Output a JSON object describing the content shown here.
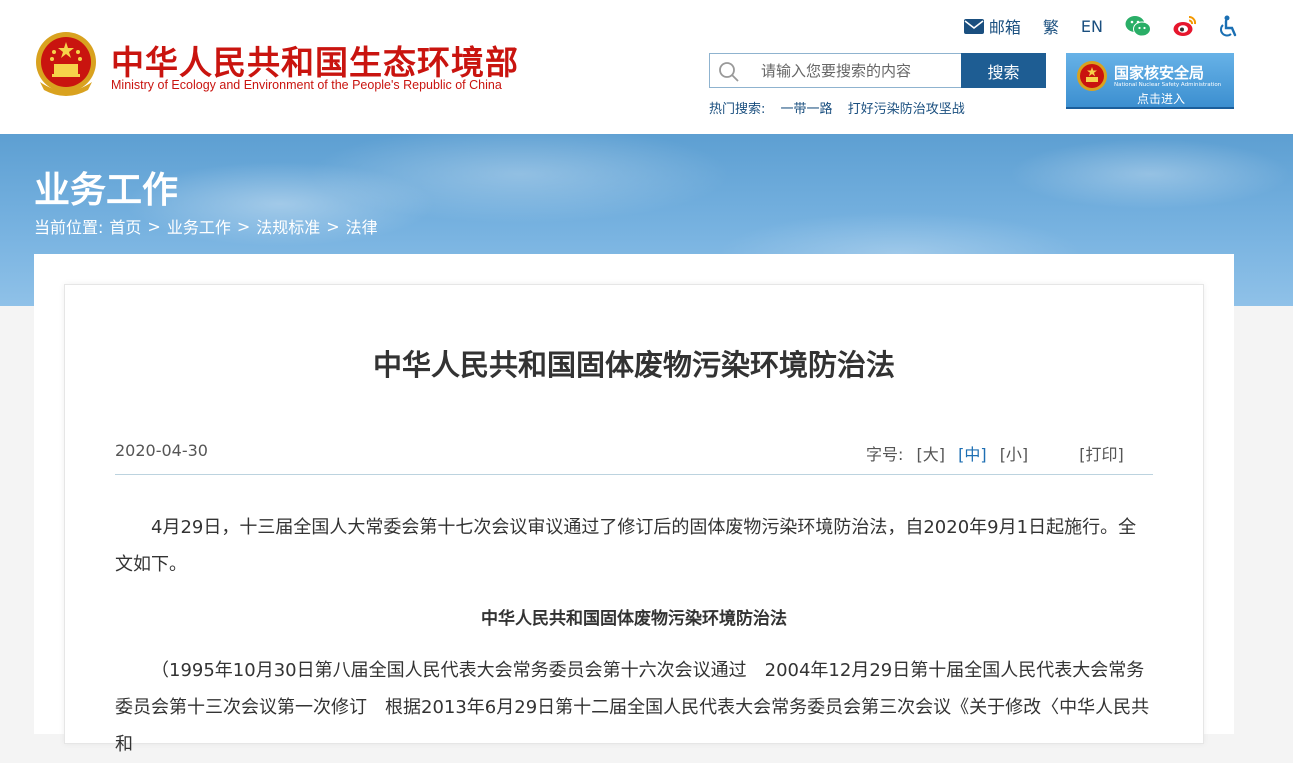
{
  "header": {
    "title_cn": "中华人民共和国生态环境部",
    "title_en": "Ministry of Ecology and Environment of the People's Republic of China",
    "toplinks": {
      "mail": "邮箱",
      "traditional": "繁",
      "english": "EN"
    },
    "search": {
      "placeholder": "请输入您要搜索的内容",
      "button": "搜索"
    },
    "hot": {
      "label": "热门搜索:",
      "items": [
        "一带一路",
        "打好污染防治攻坚战"
      ]
    },
    "nnsa": {
      "name_cn": "国家核安全局",
      "name_en": "National Nuclear Safety Administration",
      "enter": "点击进入"
    }
  },
  "banner": {
    "title": "业务工作",
    "breadcrumb": {
      "label": "当前位置:",
      "items": [
        "首页",
        "业务工作",
        "法规标准",
        "法律"
      ],
      "separator": ">"
    }
  },
  "article": {
    "title": "中华人民共和国固体废物污染环境防治法",
    "date": "2020-04-30",
    "font_size_label": "字号:",
    "font_sizes": [
      "[大]",
      "[中]",
      "[小]"
    ],
    "print": "[打印]",
    "paragraph1": "4月29日，十三届全国人大常委会第十七次会议审议通过了修订后的固体废物污染环境防治法，自2020年9月1日起施行。全文如下。",
    "subtitle": "中华人民共和国固体废物污染环境防治法",
    "paragraph2": "（1995年10月30日第八届全国人民代表大会常务委员会第十六次会议通过　2004年12月29日第十届全国人民代表大会常务委员会第十三次会议第一次修订　根据2013年6月29日第十二届全国人民代表大会常务委员会第三次会议《关于修改〈中华人民共和"
  },
  "colors": {
    "brand_red": "#c9140f",
    "nav_blue": "#1e5d93",
    "link_blue": "#1a4f7f"
  }
}
